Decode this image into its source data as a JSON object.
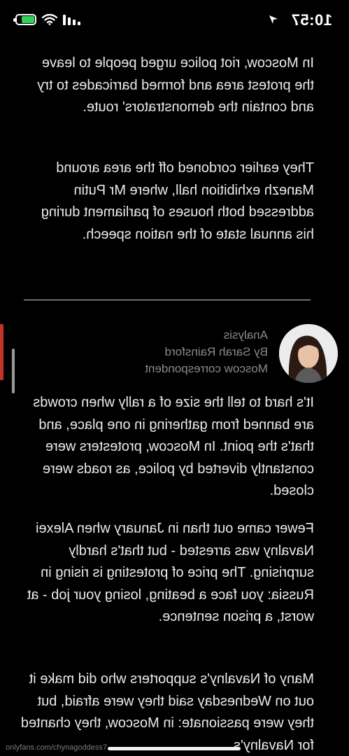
{
  "status_bar": {
    "time": "10:57",
    "location_icon": "location-arrow-icon",
    "signal_icon": "signal-bars-icon",
    "wifi_icon": "wifi-icon",
    "battery_icon": "battery-charging-icon",
    "battery_level": 0.7,
    "battery_color": "#33d15a"
  },
  "article": {
    "paragraphs": [
      "In Moscow, riot police urged people to leave the protest area and formed barricades to try and contain the demonstrators' route.",
      "They earlier cordoned off the area around Manezh exhibition hall, where Mr Putin addressed both houses of parliament during his annual state of the nation speech.",
      "It's hard to tell the size of a rally when crowds are banned from gathering in one place, and that's the point. In Moscow, protesters were constantly diverted by police, as roads were closed.",
      "Fewer came out than in January when Alexei Navalny was arrested - but that's hardly surprising. The price of protesting is rising in Russia: you face a beating, losing your job - at worst, a prison sentence.",
      "Many of Navalny's supporters who did make it out on Wednesday said they were afraid, but they were passionate: in Moscow, they chanted for Navalny's"
    ],
    "analysis": {
      "label": "Analysis",
      "byline": "By Sarah Rainsford",
      "role": "Moscow correspondent"
    },
    "accent_color": "#c0332b"
  },
  "watermark": "onlyfans.com/chynagoddess7"
}
